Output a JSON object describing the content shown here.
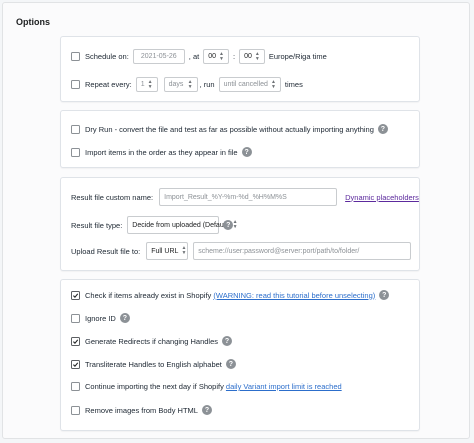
{
  "title": "Options",
  "schedule": {
    "label": "Schedule on:",
    "date": "2021-05-26",
    "at": ", at",
    "hour": "00",
    "sep": ":",
    "minute": "00",
    "timezone": "Europe/Riga time"
  },
  "repeat": {
    "label": "Repeat every:",
    "count": "1",
    "unit": "days",
    "run": ", run",
    "until": "until cancelled",
    "times": "times"
  },
  "dry_run": {
    "label": "Dry Run - convert the file and test as far as possible without actually importing anything"
  },
  "import_order": {
    "label": "Import items in the order as they appear in file"
  },
  "result_name": {
    "label": "Result file custom name:",
    "placeholder": "Import_Result_%Y-%m-%d_%H%M%S",
    "link": "Dynamic placeholders"
  },
  "result_type": {
    "label": "Result file type:",
    "value": "Decide from uploaded (Default)"
  },
  "upload": {
    "label": "Upload Result file to:",
    "protocol": "Full URL",
    "placeholder": "scheme://user:password@server:port/path/to/folder/"
  },
  "options": [
    {
      "prefix": "Check if items already exist in Shopify ",
      "link": "(WARNING: read this tutorial before unselecting)",
      "suffix": "",
      "checked": true,
      "help": true
    },
    {
      "prefix": "Ignore ID",
      "link": "",
      "suffix": "",
      "checked": false,
      "help": true
    },
    {
      "prefix": "Generate Redirects if changing Handles",
      "link": "",
      "suffix": "",
      "checked": true,
      "help": true
    },
    {
      "prefix": "Transliterate Handles to English alphabet",
      "link": "",
      "suffix": "",
      "checked": true,
      "help": true
    },
    {
      "prefix": "Continue importing the next day if Shopify ",
      "link": "daily Variant import limit is reached",
      "suffix": "",
      "checked": false,
      "help": false
    },
    {
      "prefix": "Remove images from Body HTML",
      "link": "",
      "suffix": "",
      "checked": false,
      "help": true
    }
  ],
  "help_glyph": "?"
}
